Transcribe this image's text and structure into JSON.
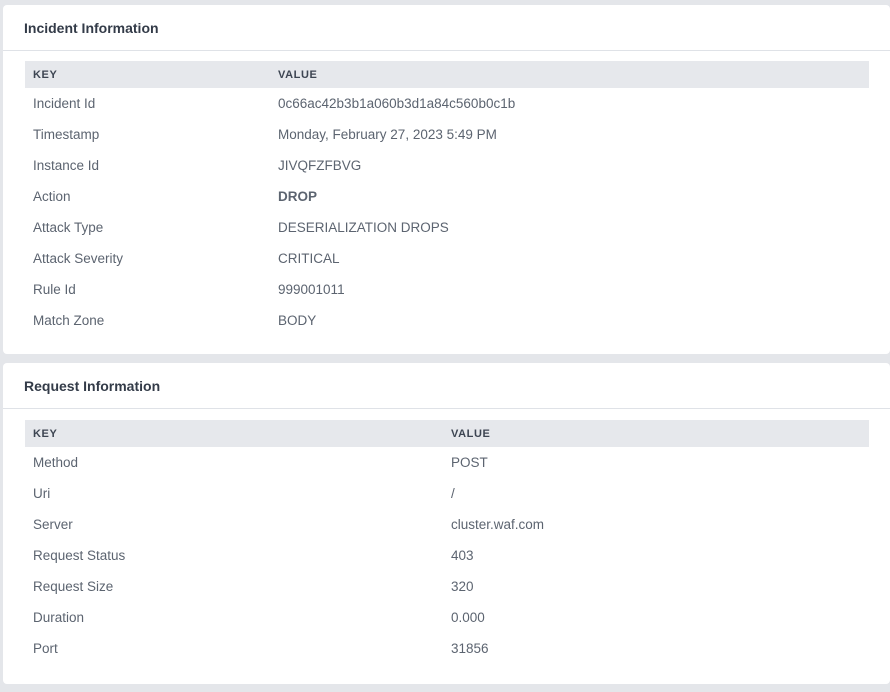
{
  "incident": {
    "title": "Incident Information",
    "col_key": "KEY",
    "col_value": "VALUE",
    "rows": [
      {
        "key": "Incident Id",
        "value": "0c66ac42b3b1a060b3d1a84c560b0c1b"
      },
      {
        "key": "Timestamp",
        "value": "Monday, February 27, 2023 5:49 PM"
      },
      {
        "key": "Instance Id",
        "value": "JIVQFZFBVG"
      },
      {
        "key": "Action",
        "value": "DROP"
      },
      {
        "key": "Attack Type",
        "value": "DESERIALIZATION DROPS"
      },
      {
        "key": "Attack Severity",
        "value": "CRITICAL"
      },
      {
        "key": "Rule Id",
        "value": "999001011"
      },
      {
        "key": "Match Zone",
        "value": "BODY"
      }
    ]
  },
  "request": {
    "title": "Request Information",
    "col_key": "KEY",
    "col_value": "VALUE",
    "rows": [
      {
        "key": "Method",
        "value": "POST"
      },
      {
        "key": "Uri",
        "value": "/"
      },
      {
        "key": "Server",
        "value": "cluster.waf.com"
      },
      {
        "key": "Request Status",
        "value": "403"
      },
      {
        "key": "Request Size",
        "value": "320"
      },
      {
        "key": "Duration",
        "value": "0.000"
      },
      {
        "key": "Port",
        "value": "31856"
      }
    ]
  },
  "colors": {
    "page_background": "#e4e6ea",
    "card_background": "#ffffff",
    "table_header_background": "#e6e8ec",
    "title_text": "#333b48",
    "body_text": "#5c6470"
  }
}
